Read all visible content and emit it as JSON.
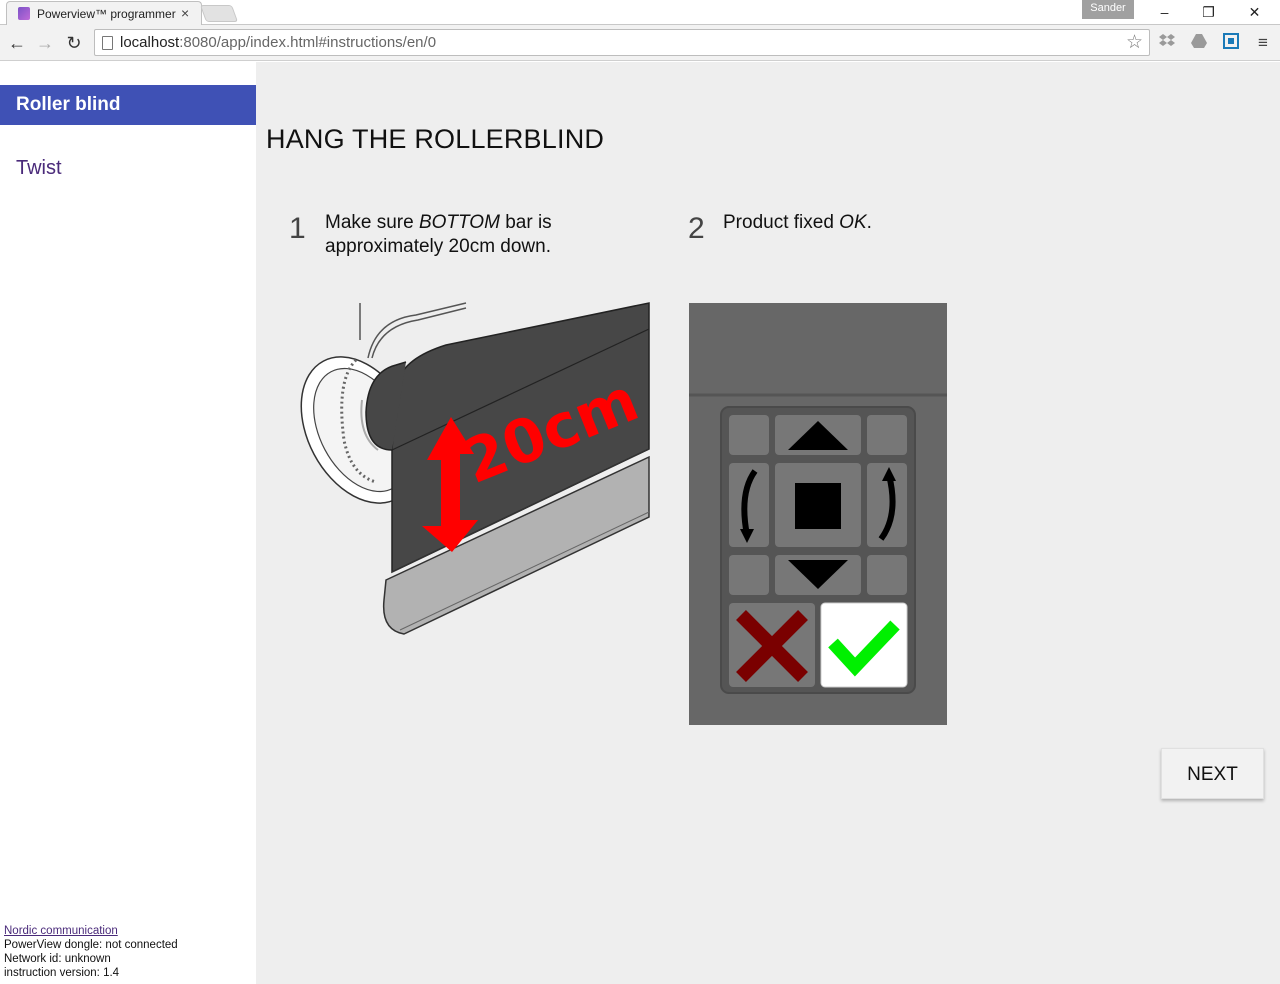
{
  "browser": {
    "tab_title": "Powerview™ programmer",
    "tab_close": "×",
    "user": "Sander",
    "url_host": "localhost",
    "url_rest": ":8080/app/index.html#instructions/en/0",
    "window_min": "–",
    "window_max": "❐",
    "window_close": "✕",
    "back": "←",
    "forward": "→",
    "reload": "↻",
    "star": "☆",
    "menu": "≡",
    "icons": [
      "dropbox-icon",
      "google-drive-icon",
      "box-icon",
      "menu-icon"
    ]
  },
  "sidebar": {
    "active_item": "Roller blind",
    "items": [
      {
        "label": "Twist"
      }
    ],
    "footer": {
      "link": "Nordic communication",
      "dongle": "PowerView dongle: not connected",
      "network": "Network id: unknown",
      "version": "instruction version: 1.4"
    }
  },
  "main": {
    "title": "HANG THE ROLLERBLIND",
    "steps": [
      {
        "num": "1",
        "text_pre": "Make sure ",
        "text_em": "BOTTOM",
        "text_post": " bar is approximately 20cm down."
      },
      {
        "num": "2",
        "text_pre": "Product fixed ",
        "text_em": "OK",
        "text_post": "."
      }
    ],
    "illustration_label": "20cm",
    "next_label": "NEXT"
  },
  "colors": {
    "accent": "#3f51b5",
    "link": "#4a2a7a",
    "blind": "#474747",
    "measure_red": "#ff0000",
    "cancel_red": "#7a0000",
    "ok_green": "#00f000"
  }
}
